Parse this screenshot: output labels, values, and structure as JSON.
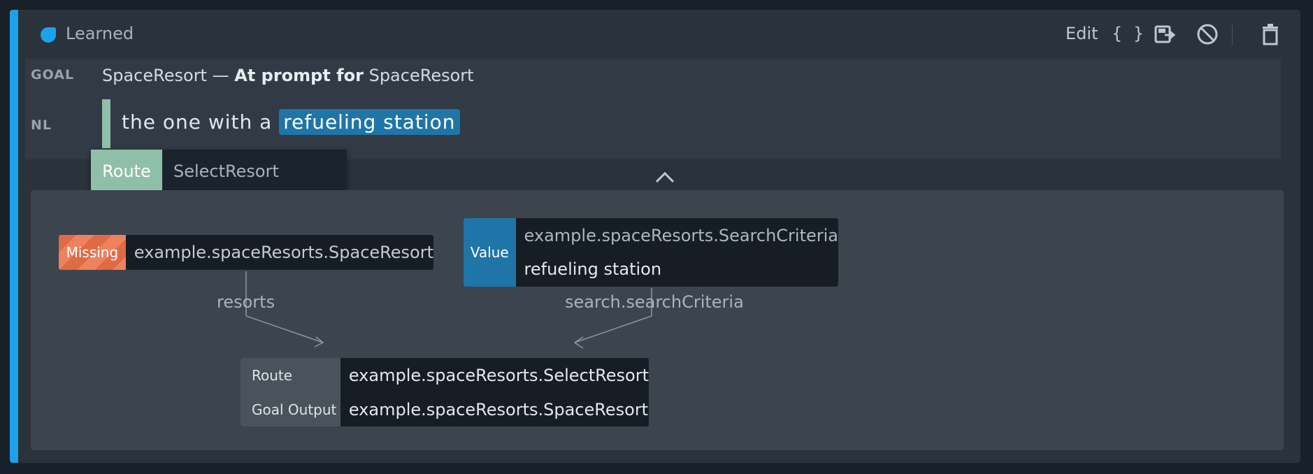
{
  "header": {
    "status": "Learned",
    "edit_label": "Edit",
    "json_label": "{ }"
  },
  "goal": {
    "label": "GOAL",
    "name": "SpaceResort",
    "separator": "—",
    "prompt_label": "At prompt for",
    "prompt_target": "SpaceResort"
  },
  "nl": {
    "label": "NL",
    "text_before": "the one with a ",
    "highlight": "refueling station"
  },
  "route_tab": {
    "label": "Route",
    "value": "SelectResort"
  },
  "graph": {
    "missing": {
      "badge": "Missing",
      "type": "example.spaceResorts.SpaceResort",
      "edge_label": "resorts"
    },
    "value": {
      "badge": "Value",
      "type": "example.spaceResorts.SearchCriteria",
      "value": "refueling station",
      "edge_label": "search.searchCriteria"
    },
    "route": {
      "route_key": "Route",
      "route_value": "example.spaceResorts.SelectResort",
      "output_key": "Goal Output",
      "output_value": "example.spaceResorts.SpaceResort"
    }
  },
  "colors": {
    "accent": "#1da1e8",
    "route": "#8fbfa8",
    "missing": "#e06a44",
    "value": "#1f75a8"
  }
}
